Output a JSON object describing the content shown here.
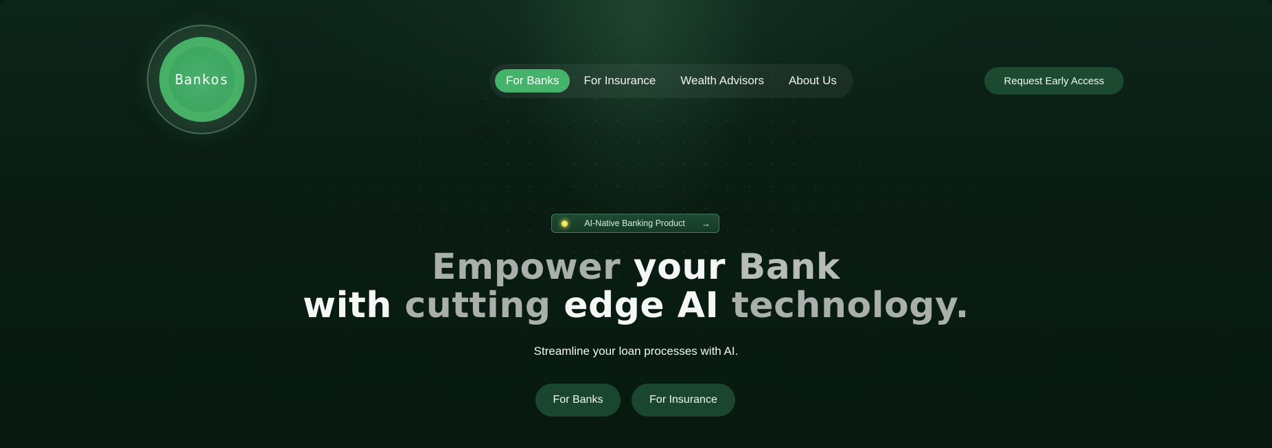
{
  "logo": {
    "text": "Bankos"
  },
  "nav": {
    "items": [
      {
        "label": "For Banks",
        "active": true
      },
      {
        "label": "For Insurance",
        "active": false
      },
      {
        "label": "Wealth Advisors",
        "active": false
      },
      {
        "label": "About Us",
        "active": false
      }
    ]
  },
  "header": {
    "cta_label": "Request Early Access"
  },
  "hero": {
    "badge_text": "AI-Native Banking Product",
    "badge_arrow": "→",
    "headline": {
      "line1": {
        "part1": "Empower ",
        "part2": "your",
        "part3": " Bank"
      },
      "line2": {
        "part1": "with ",
        "part2": "cutting",
        "part3": " edge AI ",
        "part4": "technology."
      }
    },
    "subtitle": "Streamline your loan processes with AI.",
    "buttons": {
      "banks_label": "For Banks",
      "insurance_label": "For Insurance"
    }
  },
  "colors": {
    "background": "#0a1f14",
    "accent_green": "#45b36a",
    "button_dark_green": "#1a4630",
    "badge_dot": "#f3e866"
  }
}
